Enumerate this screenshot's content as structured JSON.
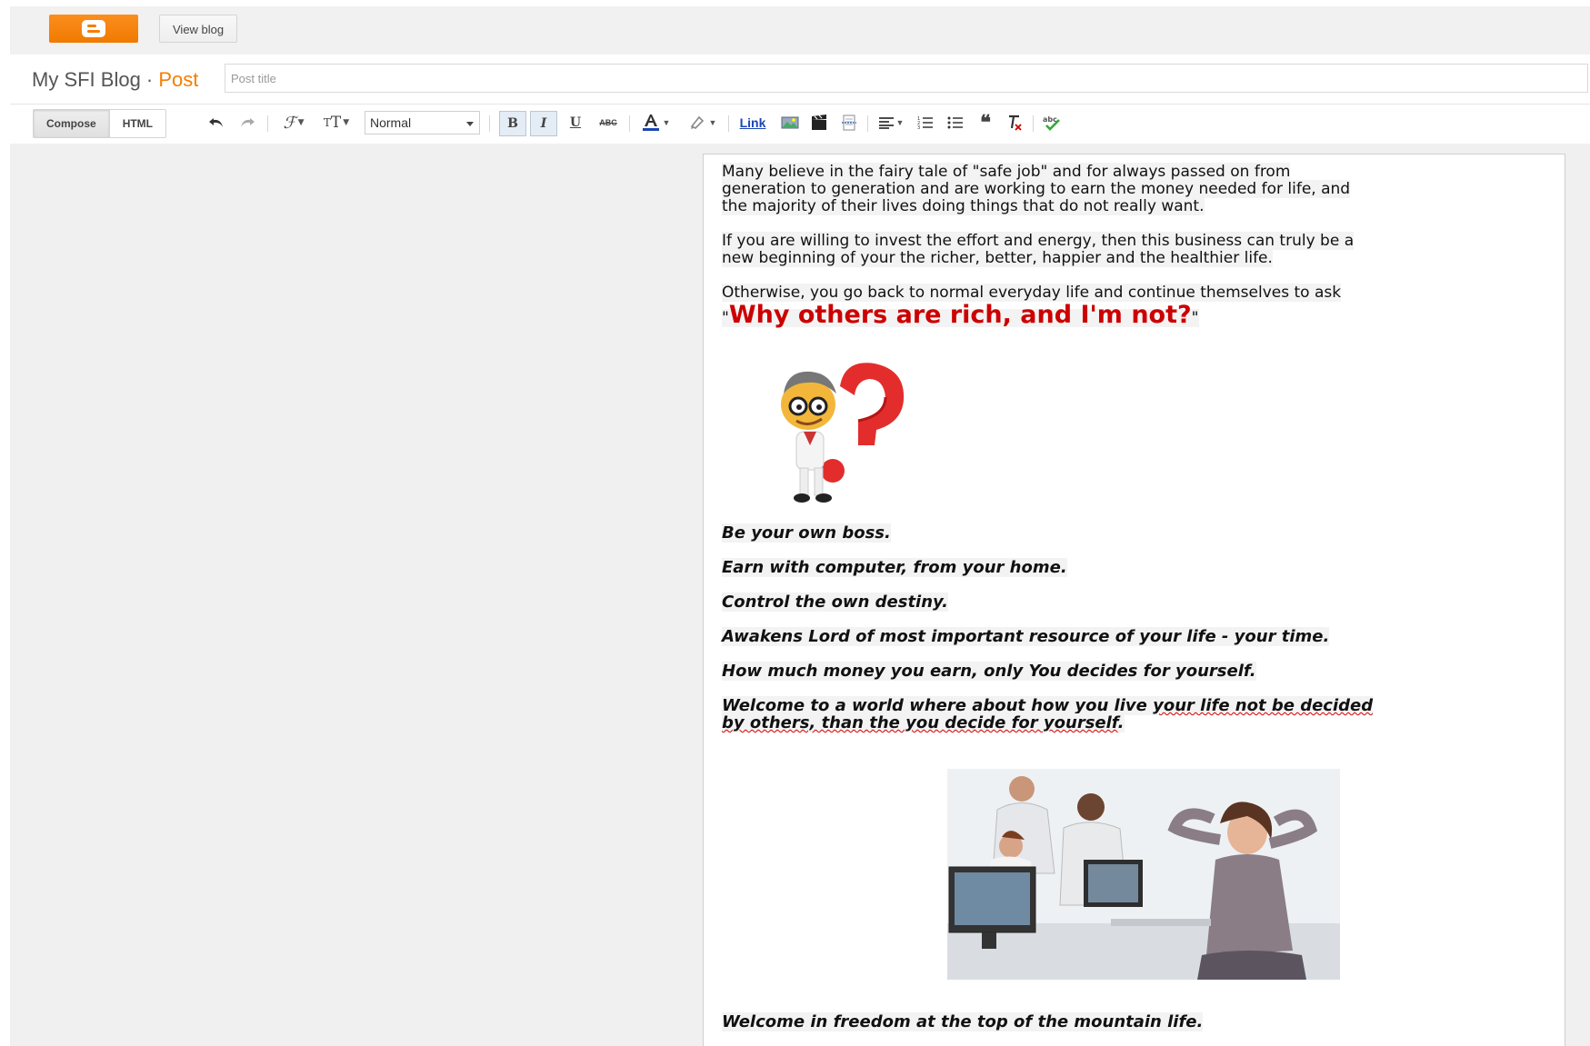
{
  "topbar": {
    "logo_icon": "blogger-logo-icon",
    "view_blog_label": "View blog"
  },
  "titlebar": {
    "blog_name": "My SFI Blog",
    "separator": " · ",
    "crumb": "Post",
    "post_title_placeholder": "Post title",
    "post_title_value": ""
  },
  "toolbar": {
    "compose_label": "Compose",
    "html_label": "HTML",
    "format_value": "Normal",
    "link_label": "Link",
    "bold_glyph": "B",
    "italic_glyph": "I",
    "underline_glyph": "U",
    "strike_glyph": "ABC",
    "icons": [
      "undo-icon",
      "redo-icon",
      "font-family-icon",
      "font-size-icon",
      "bold-icon",
      "italic-icon",
      "underline-icon",
      "strikethrough-icon",
      "text-color-icon",
      "highlight-color-icon",
      "link-icon",
      "insert-image-icon",
      "insert-video-icon",
      "insert-jump-break-icon",
      "align-icon",
      "numbered-list-icon",
      "bullet-list-icon",
      "quote-icon",
      "remove-formatting-icon",
      "spell-check-icon"
    ]
  },
  "post": {
    "para1_line1": "Many believe in the fairy tale of \"safe job\" and for always passed on from",
    "para1_line2": "generation to generation and are working to earn the money needed for life, and",
    "para1_line3": "the majority of their lives doing things that do not really want.",
    "para2_line1": "If you are willing to invest the effort and energy, then this business can truly be a",
    "para2_line2": "new beginning of your the richer, better, happier and the healthier life.",
    "para3_line1": "Otherwise, you go back to normal everyday life and continue themselves to ask",
    "quote_open": "\"",
    "headline": "Why others are rich, and I'm not?",
    "quote_close": "\"",
    "line_boss": "Be your own boss.",
    "line_computer": "Earn with computer, from your home.",
    "line_destiny": "Control the own destiny.",
    "line_lord": "Awakens Lord of most important resource of your life - your time.",
    "line_money": "How much money you earn, only You decides for yourself.",
    "welcome_a": "Welcome to a world where about how you live ",
    "welcome_b": "your life not be decided",
    "welcome_c": "by others, than the you decide for yourself",
    "welcome_d": ".",
    "line_freedom": "Welcome in freedom at the top of the mountain life."
  },
  "colors": {
    "blogger_orange": "#f57d00",
    "headline_red": "#cc0000",
    "link_blue": "#1a46b4"
  }
}
